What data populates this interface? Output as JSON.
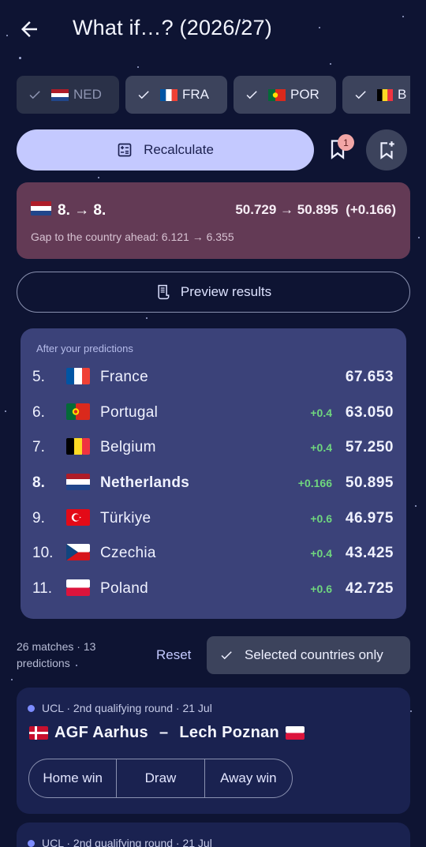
{
  "header": {
    "title": "What if…? (2026/27)"
  },
  "chips": [
    {
      "label": "NED",
      "selected": false
    },
    {
      "label": "FRA",
      "selected": true
    },
    {
      "label": "POR",
      "selected": true
    },
    {
      "label": "B",
      "selected": true
    }
  ],
  "actions": {
    "recalculate_label": "Recalculate",
    "bookmark_badge": "1",
    "preview_label": "Preview results"
  },
  "status": {
    "rank": "8. → 8.",
    "points": "50.729 → 50.895  (+0.166)",
    "gap": "Gap to the country ahead: 6.121 → 6.355"
  },
  "standings": {
    "caption": "After your predictions",
    "rows": [
      {
        "pos": "5.",
        "name": "France",
        "delta": "",
        "score": "67.653"
      },
      {
        "pos": "6.",
        "name": "Portugal",
        "delta": "+0.4",
        "score": "63.050"
      },
      {
        "pos": "7.",
        "name": "Belgium",
        "delta": "+0.4",
        "score": "57.250"
      },
      {
        "pos": "8.",
        "name": "Netherlands",
        "delta": "+0.166",
        "score": "50.895"
      },
      {
        "pos": "9.",
        "name": "Türkiye",
        "delta": "+0.6",
        "score": "46.975"
      },
      {
        "pos": "10.",
        "name": "Czechia",
        "delta": "+0.4",
        "score": "43.425"
      },
      {
        "pos": "11.",
        "name": "Poland",
        "delta": "+0.6",
        "score": "42.725"
      }
    ]
  },
  "filter": {
    "count_line1": "26 matches · 13",
    "count_line2": "predictions",
    "reset_label": "Reset",
    "selected_only_label": "Selected countries only"
  },
  "matches": [
    {
      "meta": "UCL · 2nd qualifying round · 21 Jul",
      "home": "AGF Aarhus",
      "sep": "–",
      "away": "Lech Poznan",
      "options": [
        "Home win",
        "Draw",
        "Away win"
      ]
    },
    {
      "meta": "UCL · 2nd qualifying round · 21 Jul"
    }
  ],
  "colors": {
    "accent": "#c4c9ff",
    "positive": "#6fd67e",
    "status_bg": "#633a55",
    "panel": "#3b4279"
  }
}
